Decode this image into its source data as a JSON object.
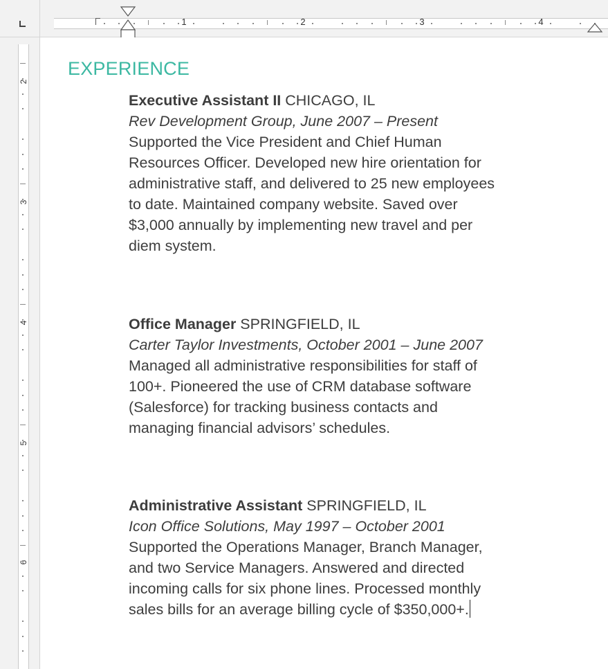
{
  "ruler": {
    "horizontal_numbers": [
      "1",
      "2",
      "3",
      "4"
    ],
    "vertical_numbers": [
      "2",
      "3",
      "4",
      "5",
      "6"
    ]
  },
  "document": {
    "heading": "EXPERIENCE",
    "accent_color": "#3cb8a2",
    "jobs": [
      {
        "role": "Executive Assistant II",
        "location": " CHICAGO, IL",
        "company_dates": "Rev Development Group, June 2007 – Present",
        "description_lines": [
          "Supported the Vice President and Chief Human",
          "Resources Officer. Developed new hire orientation for",
          "administrative staff, and delivered to 25 new employees",
          "to date. Maintained company website. Saved over",
          "$3,000 annually by implementing new travel and per",
          "diem system."
        ]
      },
      {
        "role": "Office Manager",
        "location": " SPRINGFIELD, IL",
        "company_dates": "Carter Taylor Investments, October 2001 – June 2007",
        "description_lines": [
          "Managed all administrative responsibilities for staff of",
          "100+. Pioneered the use of CRM database software",
          "(Salesforce) for tracking business contacts and",
          "managing financial advisors’ schedules."
        ]
      },
      {
        "role": "Administrative Assistant",
        "location": " SPRINGFIELD, IL",
        "company_dates": "Icon Office Solutions, May 1997 – October 2001",
        "description_lines": [
          "Supported the Operations Manager, Branch Manager,",
          "and two Service Managers. Answered and directed",
          "incoming calls for six phone lines. Processed monthly",
          "sales bills for an average billing cycle of $350,000+."
        ]
      }
    ]
  }
}
